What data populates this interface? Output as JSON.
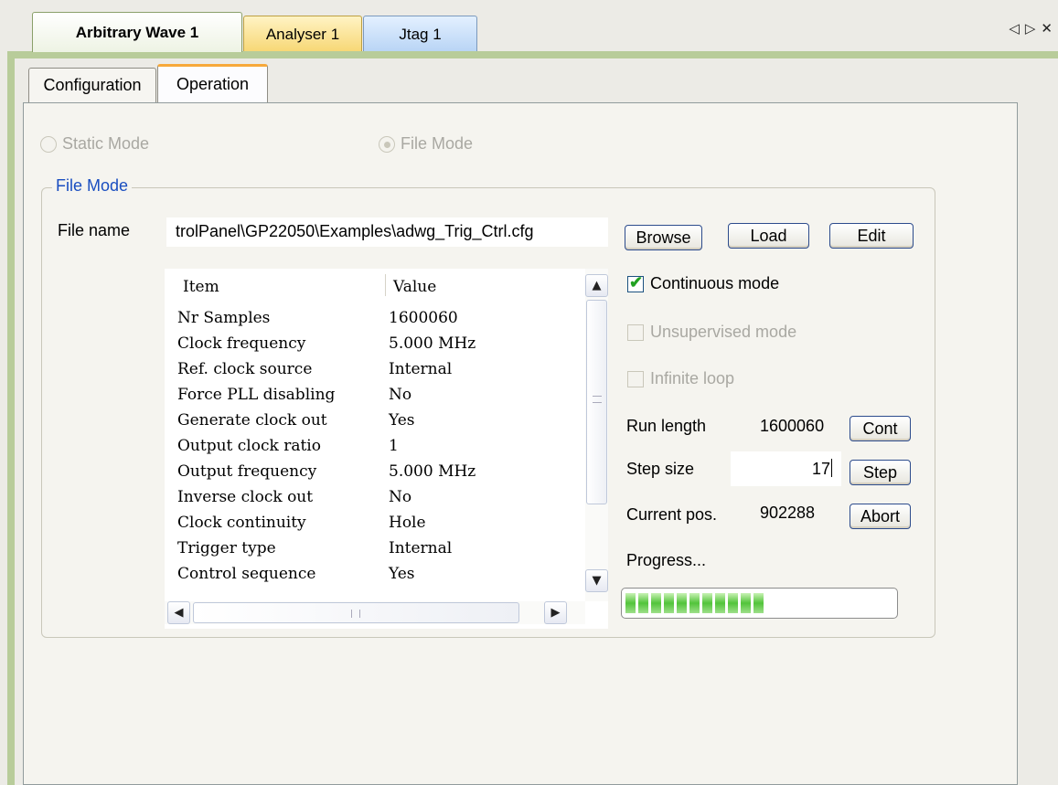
{
  "document_tabs": [
    {
      "label": "Arbitrary Wave 1",
      "active": true
    },
    {
      "label": "Analyser 1",
      "active": false
    },
    {
      "label": "Jtag 1",
      "active": false
    }
  ],
  "nav": {
    "left": "◁",
    "right": "▷",
    "close": "✕"
  },
  "inner_tabs": [
    {
      "label": "Configuration",
      "active": false
    },
    {
      "label": "Operation",
      "active": true
    }
  ],
  "modes": {
    "static_label": "Static Mode",
    "file_label": "File Mode",
    "selected": "File Mode"
  },
  "file_mode": {
    "group_title": "File Mode",
    "file_name_label": "File name",
    "file_name_value": "trolPanel\\GP22050\\Examples\\adwg_Trig_Ctrl.cfg",
    "browse": "Browse",
    "load": "Load",
    "edit": "Edit"
  },
  "list": {
    "headers": [
      "Item",
      "Value"
    ],
    "rows": [
      [
        "Nr Samples",
        "1600060"
      ],
      [
        "Clock frequency",
        "5.000 MHz"
      ],
      [
        "Ref. clock source",
        "Internal"
      ],
      [
        "Force PLL disabling",
        "No"
      ],
      [
        "Generate clock out",
        "Yes"
      ],
      [
        "Output clock ratio",
        "1"
      ],
      [
        "Output frequency",
        "5.000 MHz"
      ],
      [
        "Inverse clock out",
        "No"
      ],
      [
        "Clock continuity",
        "Hole"
      ],
      [
        "Trigger type",
        "Internal"
      ],
      [
        "Control sequence",
        "Yes"
      ]
    ]
  },
  "options": {
    "continuous": {
      "label": "Continuous mode",
      "checked": true
    },
    "unsupervised": {
      "label": "Unsupervised mode",
      "checked": false
    },
    "infinite": {
      "label": "Infinite loop",
      "checked": false
    }
  },
  "run": {
    "run_length_label": "Run length",
    "run_length_value": "1600060",
    "cont": "Cont",
    "step_size_label": "Step size",
    "step_size_value": "17",
    "step": "Step",
    "current_pos_label": "Current pos.",
    "current_pos_value": "902288",
    "abort": "Abort",
    "progress_label": "Progress...",
    "progress_fraction": 0.56
  },
  "colors": {
    "accent_tab": "#f7a93b",
    "progress_green": "#52c43a",
    "group_title": "#1a4ec0"
  }
}
